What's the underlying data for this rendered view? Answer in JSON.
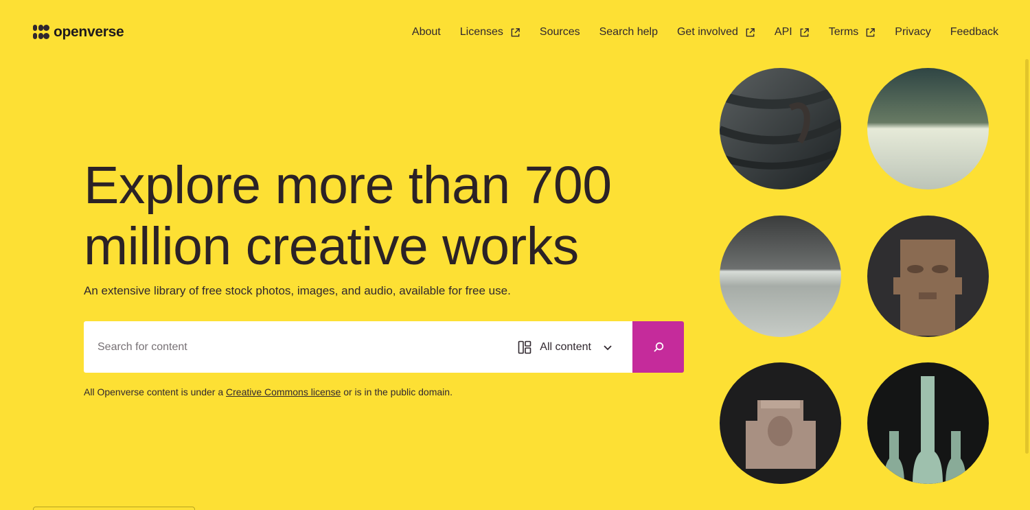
{
  "brand": {
    "name": "openverse"
  },
  "nav": {
    "items": [
      {
        "label": "About",
        "external": false
      },
      {
        "label": "Licenses",
        "external": true
      },
      {
        "label": "Sources",
        "external": false
      },
      {
        "label": "Search help",
        "external": false
      },
      {
        "label": "Get involved",
        "external": true
      },
      {
        "label": "API",
        "external": true
      },
      {
        "label": "Terms",
        "external": true
      },
      {
        "label": "Privacy",
        "external": false
      },
      {
        "label": "Feedback",
        "external": false
      }
    ]
  },
  "hero": {
    "title": "Explore more than 700 million creative works",
    "subtitle": "An extensive library of free stock photos, images, and audio, available for free use."
  },
  "search": {
    "placeholder": "Search for content",
    "content_type": "All content"
  },
  "license_note": {
    "before": "All Openverse content is under a ",
    "link": "Creative Commons license",
    "after": " or is in the public domain."
  },
  "colors": {
    "background": "#fde034",
    "accent": "#c52b9b",
    "text": "#30272e"
  }
}
